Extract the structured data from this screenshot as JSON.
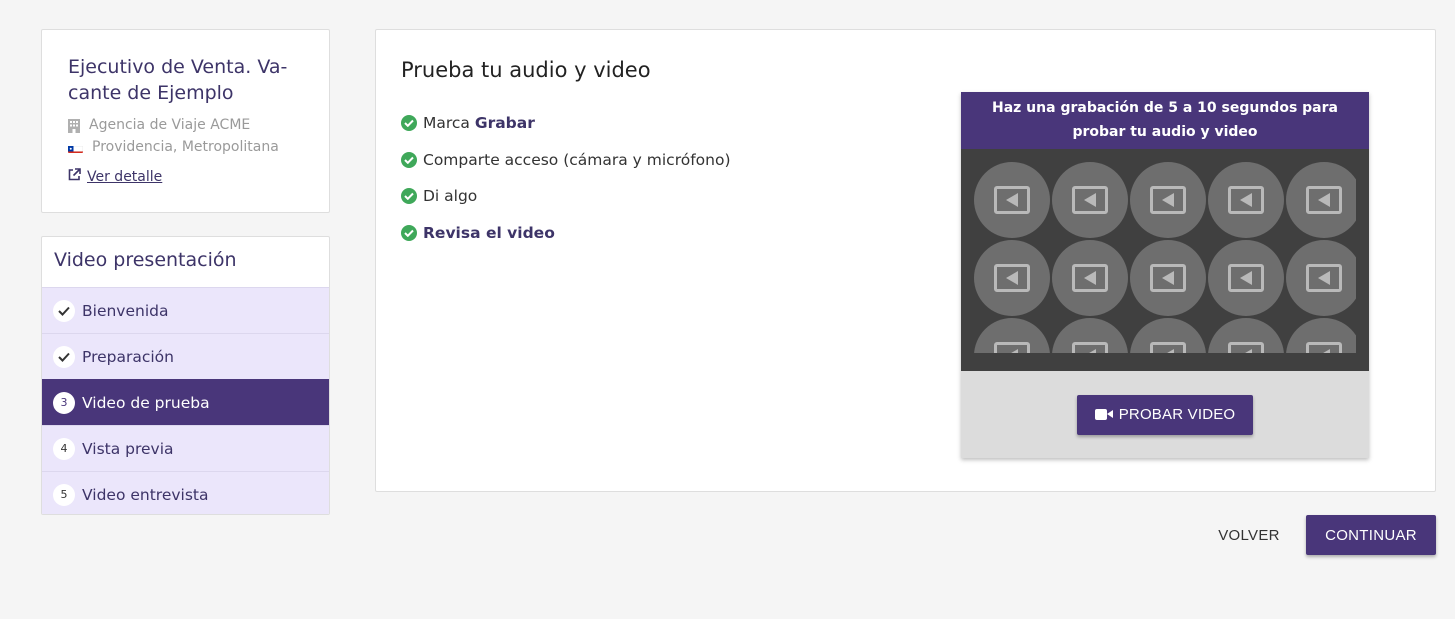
{
  "job": {
    "title": "Ejecutivo de Venta. Vacante de Ejemplo",
    "title_line1": "Ejecutivo de Venta. Va-",
    "title_line2": "cante de Ejemplo",
    "company": "Agencia de Viaje ACME",
    "location": "Providencia, Metropolitana",
    "detail_link": "Ver detalle"
  },
  "steps": {
    "title": "Video presentación",
    "items": [
      {
        "label": "Bienvenida",
        "badge": "✓",
        "state": "done"
      },
      {
        "label": "Preparación",
        "badge": "✓",
        "state": "done"
      },
      {
        "label": "Video de prueba",
        "badge": "3",
        "state": "active"
      },
      {
        "label": "Vista previa",
        "badge": "4",
        "state": "pending"
      },
      {
        "label": "Video entrevista",
        "badge": "5",
        "state": "pending"
      }
    ]
  },
  "main": {
    "title": "Prueba tu audio y video",
    "checklist": [
      {
        "prefix": "Marca ",
        "strong": "Grabar"
      },
      {
        "prefix": "Comparte acceso (cámara y micrófono)",
        "strong": ""
      },
      {
        "prefix": "Di algo",
        "strong": ""
      },
      {
        "prefix": "",
        "strong": "Revisa el video"
      }
    ]
  },
  "video_widget": {
    "header": "Haz una grabación de 5 a 10 segundos para probar tu audio y video",
    "button_label": "PROBAR VIDEO"
  },
  "footer": {
    "back_label": "VOLVER",
    "continue_label": "CONTINUAR"
  },
  "colors": {
    "primary": "#49367a",
    "step_bg": "#ebe6fb",
    "check_green": "#3fa85a"
  }
}
